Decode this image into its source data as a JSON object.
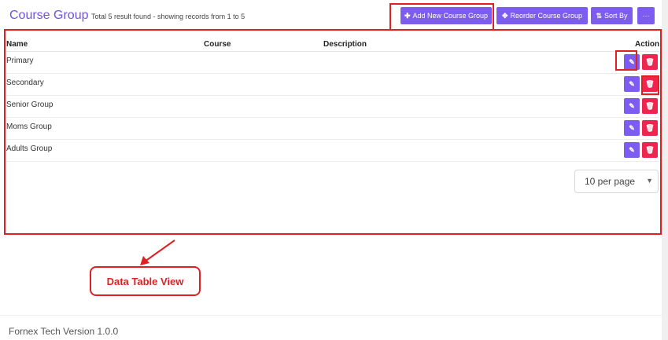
{
  "header": {
    "title": "Course Group",
    "result_info": "Total 5 result found - showing records from 1 to 5",
    "add_button": "Add New Course Group",
    "reorder_button": "Reorder Course Group",
    "sort_button": "Sort By",
    "more_button": "···"
  },
  "table": {
    "columns": {
      "name": "Name",
      "course": "Course",
      "description": "Description",
      "action": "Action"
    },
    "rows": [
      {
        "name": "Primary"
      },
      {
        "name": "Secondary"
      },
      {
        "name": "Senior Group"
      },
      {
        "name": "Moms Group"
      },
      {
        "name": "Adults Group"
      }
    ]
  },
  "pagination": {
    "per_page": "10 per page"
  },
  "annotation": {
    "label": "Data Table View",
    "color": "#e02020"
  },
  "footer": {
    "text": "Fornex Tech Version 1.0.0"
  },
  "colors": {
    "accent": "#7c5df0",
    "danger": "#f0254f",
    "title": "#6f52e0"
  }
}
